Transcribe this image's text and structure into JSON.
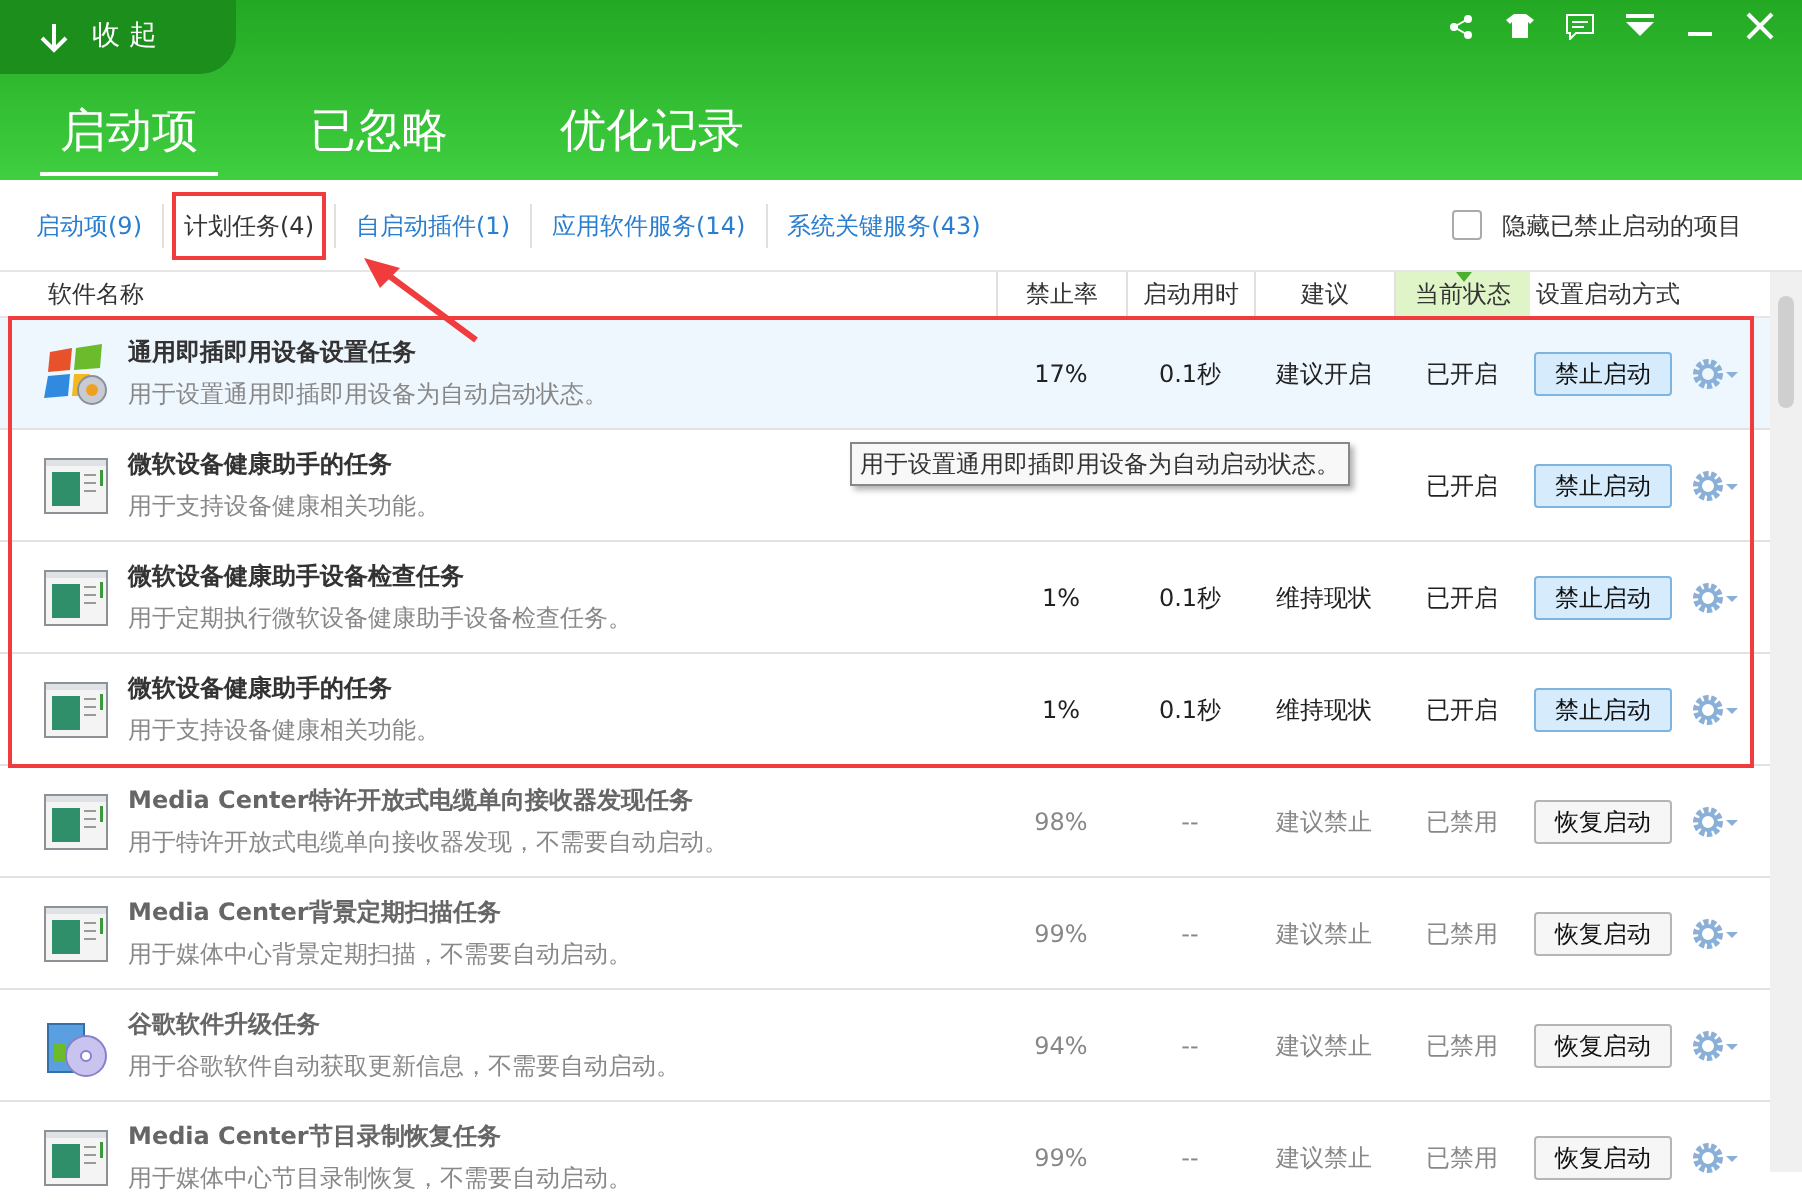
{
  "collapse_button": {
    "label": "收 起"
  },
  "main_tabs": [
    {
      "label": "启动项",
      "selected": true
    },
    {
      "label": "已忽略",
      "selected": false
    },
    {
      "label": "优化记录",
      "selected": false
    }
  ],
  "sub_tabs": [
    {
      "label": "启动项(9)",
      "selected": false,
      "highlighted": false
    },
    {
      "label": "计划任务(4)",
      "selected": true,
      "highlighted": true
    },
    {
      "label": "自启动插件(1)",
      "selected": false,
      "highlighted": false
    },
    {
      "label": "应用软件服务(14)",
      "selected": false,
      "highlighted": false
    },
    {
      "label": "系统关键服务(43)",
      "selected": false,
      "highlighted": false
    }
  ],
  "hide_disabled": {
    "label": "隐藏已禁止启动的项目",
    "checked": false
  },
  "columns": [
    {
      "label": "软件名称",
      "sorted": false
    },
    {
      "label": "禁止率",
      "sorted": false
    },
    {
      "label": "启动用时",
      "sorted": false
    },
    {
      "label": "建议",
      "sorted": false
    },
    {
      "label": "当前状态",
      "sorted": true
    },
    {
      "label": "设置启动方式",
      "sorted": false
    }
  ],
  "rows": [
    {
      "kind": "windows",
      "name": "通用即插即用设备设置任务",
      "description": "用于设置通用即插即用设备为自动启动状态。",
      "rate": "17%",
      "time": "0.1秒",
      "advice": "建议开启",
      "status": "已开启",
      "action": "禁止启动",
      "enabled": true,
      "selected": true,
      "highlighted": true
    },
    {
      "kind": "window",
      "name": "微软设备健康助手的任务",
      "description": "用于支持设备健康相关功能。",
      "status": "已开启",
      "action": "禁止启动",
      "enabled": true,
      "selected": false,
      "highlighted": true
    },
    {
      "kind": "window",
      "name": "微软设备健康助手设备检查任务",
      "description": "用于定期执行微软设备健康助手设备检查任务。",
      "rate": "1%",
      "time": "0.1秒",
      "advice": "维持现状",
      "status": "已开启",
      "action": "禁止启动",
      "enabled": true,
      "selected": false,
      "highlighted": true
    },
    {
      "kind": "window",
      "name": "微软设备健康助手的任务",
      "description": "用于支持设备健康相关功能。",
      "rate": "1%",
      "time": "0.1秒",
      "advice": "维持现状",
      "status": "已开启",
      "action": "禁止启动",
      "enabled": true,
      "selected": false,
      "highlighted": true
    },
    {
      "kind": "window",
      "name": "Media Center特许开放式电缆单向接收器发现任务",
      "description": "用于特许开放式电缆单向接收器发现，不需要自动启动。",
      "rate": "98%",
      "time": "--",
      "advice": "建议禁止",
      "status": "已禁用",
      "action": "恢复启动",
      "enabled": false,
      "selected": false,
      "highlighted": false
    },
    {
      "kind": "window",
      "name": "Media Center背景定期扫描任务",
      "description": "用于媒体中心背景定期扫描，不需要自动启动。",
      "rate": "99%",
      "time": "--",
      "advice": "建议禁止",
      "status": "已禁用",
      "action": "恢复启动",
      "enabled": false,
      "selected": false,
      "highlighted": false
    },
    {
      "kind": "disc",
      "name": "谷歌软件升级任务",
      "description": "用于谷歌软件自动获取更新信息，不需要自动启动。",
      "rate": "94%",
      "time": "--",
      "advice": "建议禁止",
      "status": "已禁用",
      "action": "恢复启动",
      "enabled": false,
      "selected": false,
      "highlighted": false
    },
    {
      "kind": "window",
      "name": "Media Center节目录制恢复任务",
      "description": "用于媒体中心节目录制恢复，不需要自动启动。",
      "rate": "99%",
      "time": "--",
      "advice": "建议禁止",
      "status": "已禁用",
      "action": "恢复启动",
      "enabled": false,
      "selected": false,
      "highlighted": false
    }
  ],
  "tooltip": {
    "text": "用于设置通用即插即用设备为自动启动状态。"
  }
}
